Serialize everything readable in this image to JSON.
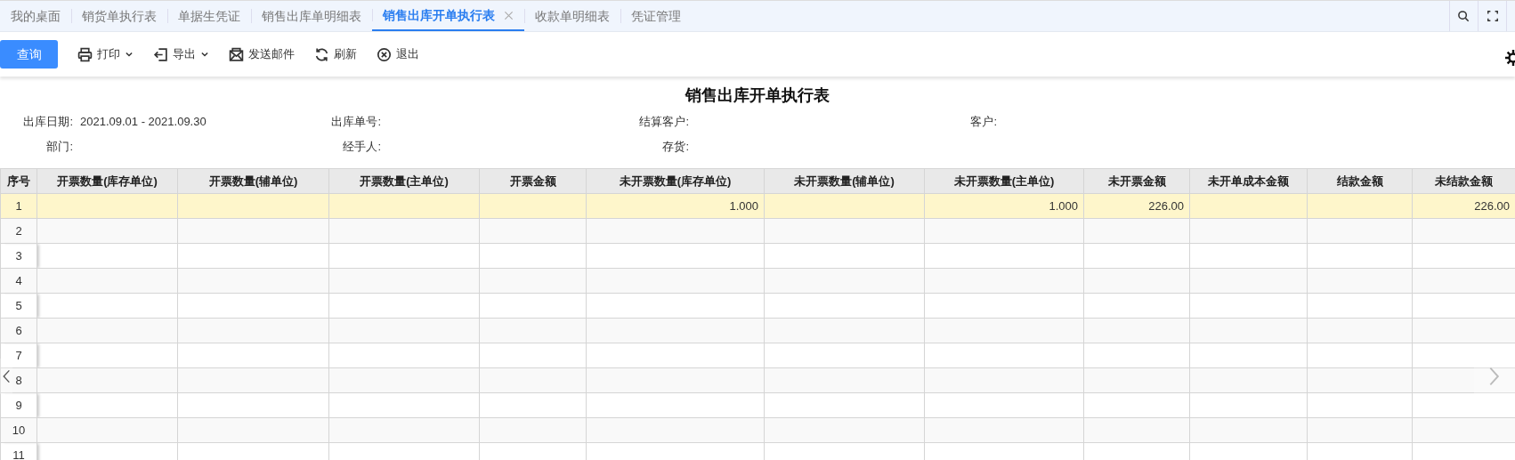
{
  "tabs": [
    {
      "label": "我的桌面",
      "selected": false,
      "closable": false
    },
    {
      "label": "销货单执行表",
      "selected": false,
      "closable": false
    },
    {
      "label": "单据生凭证",
      "selected": false,
      "closable": false
    },
    {
      "label": "销售出库单明细表",
      "selected": false,
      "closable": false
    },
    {
      "label": "销售出库开单执行表",
      "selected": true,
      "closable": true
    },
    {
      "label": "收款单明细表",
      "selected": false,
      "closable": false
    },
    {
      "label": "凭证管理",
      "selected": false,
      "closable": false
    }
  ],
  "toolbar": {
    "query_button": "查询",
    "items": [
      {
        "kind": "print",
        "label": "打印",
        "dropdown": true
      },
      {
        "kind": "export",
        "label": "导出",
        "dropdown": true
      },
      {
        "kind": "mail",
        "label": "发送邮件",
        "dropdown": false
      },
      {
        "kind": "refresh",
        "label": "刷新",
        "dropdown": false
      },
      {
        "kind": "exit",
        "label": "退出",
        "dropdown": false
      }
    ]
  },
  "report": {
    "title": "销售出库开单执行表",
    "filters": [
      [
        {
          "label": "出库日期:",
          "value": "2021.09.01 - 2021.09.30"
        },
        {
          "label": "出库单号:"
        },
        {
          "label": "结算客户:"
        },
        {
          "label": "客户:"
        }
      ],
      [
        {
          "label": "部门:"
        },
        {
          "label": "经手人:"
        },
        {
          "label": "存货:"
        }
      ]
    ]
  },
  "table": {
    "columns": [
      "序号",
      "开票数量(库存单位)",
      "开票数量(辅单位)",
      "开票数量(主单位)",
      "开票金额",
      "未开票数量(库存单位)",
      "未开票数量(辅单位)",
      "未开票数量(主单位)",
      "未开票金额",
      "未开单成本金额",
      "结款金额",
      "未结款金额"
    ],
    "rows": [
      {
        "no": "1",
        "selected": true,
        "cells": [
          null,
          null,
          null,
          null,
          "1.000",
          null,
          "1.000",
          "226.00",
          null,
          null,
          "226.00"
        ]
      },
      {
        "no": "2",
        "selected": false
      },
      {
        "no": "3",
        "selected": false
      },
      {
        "no": "4",
        "selected": false
      },
      {
        "no": "5",
        "selected": false
      },
      {
        "no": "6",
        "selected": false
      },
      {
        "no": "7",
        "selected": false
      },
      {
        "no": "8",
        "selected": false
      },
      {
        "no": "9",
        "selected": false
      },
      {
        "no": "10",
        "selected": false
      },
      {
        "no": "11",
        "selected": false
      }
    ]
  }
}
